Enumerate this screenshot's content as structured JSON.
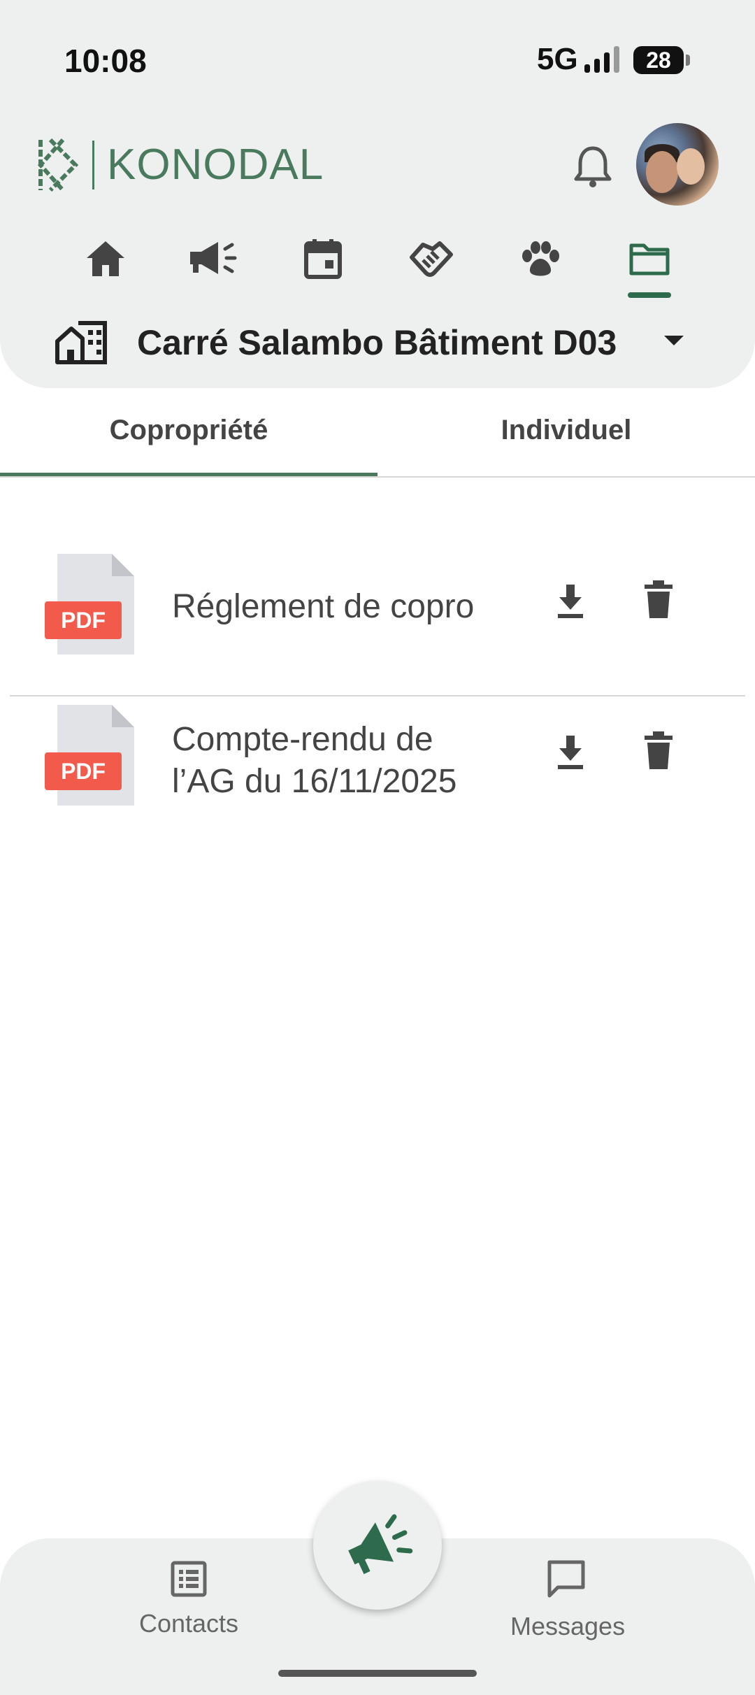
{
  "status_bar": {
    "time": "10:08",
    "network": "5G",
    "battery": "28"
  },
  "app": {
    "brand": "KONODAL"
  },
  "building": {
    "name": "Carré Salambo Bâtiment D03"
  },
  "tabs": [
    {
      "label": "Copropriété",
      "active": true
    },
    {
      "label": "Individuel",
      "active": false
    }
  ],
  "documents": [
    {
      "type_label": "PDF",
      "title": "Réglement de copro"
    },
    {
      "type_label": "PDF",
      "title_line1": "Compte-rendu de",
      "title_line2": "l’AG du 16/11/2025"
    }
  ],
  "bottom_nav": {
    "contacts_label": "Contacts",
    "messages_label": "Messages"
  },
  "colors": {
    "accent": "#4a7a5d",
    "header_bg": "#edf0ef",
    "pdf_red": "#f25b4b"
  },
  "nav_icons": [
    "home-icon",
    "megaphone-icon",
    "calendar-icon",
    "handshake-icon",
    "paw-icon",
    "folder-icon"
  ]
}
